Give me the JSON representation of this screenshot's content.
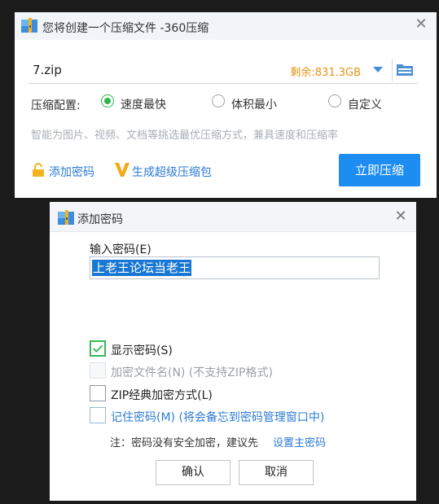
{
  "main_window": {
    "title": "您将创建一个压缩文件 -360压缩",
    "file_name": "7.zip",
    "space_left": "剩余:831.3GB",
    "config_label": "压缩配置:",
    "radio_options": [
      {
        "label": "速度最快",
        "checked": true
      },
      {
        "label": "体积最小",
        "checked": false
      },
      {
        "label": "自定义",
        "checked": false
      }
    ],
    "hint": "智能为图片、视频、文档等挑选最优压缩方式，兼具速度和压缩率",
    "add_password": "添加密码",
    "super_package": "生成超级压缩包",
    "compress_button": "立即压缩",
    "icons": {
      "app": "archive-app-icon",
      "folder": "folder-icon",
      "lock": "lock-icon",
      "v": "v-badge-icon"
    }
  },
  "password_dialog": {
    "title": "添加密码",
    "input_label": "输入密码(E)",
    "input_value": "上老王论坛当老王",
    "checkboxes": [
      {
        "label": "显示密码(S)",
        "checked": true,
        "disabled": false
      },
      {
        "label": "加密文件名(N) (不支持ZIP格式)",
        "checked": false,
        "disabled": true
      },
      {
        "label": "ZIP经典加密方式(L)",
        "checked": false,
        "disabled": false
      },
      {
        "label": "记住密码(M) (将会备忘到密码管理窗口中)",
        "checked": false,
        "disabled": false
      }
    ],
    "note_prefix": "注：密码没有安全加密，建议先",
    "note_link": "设置主密码",
    "ok_button": "确认",
    "cancel_button": "取消"
  },
  "colors": {
    "accent": "#1e8df1",
    "green": "#2cb54f",
    "orange": "#e39315",
    "link": "#2b7bd6"
  }
}
